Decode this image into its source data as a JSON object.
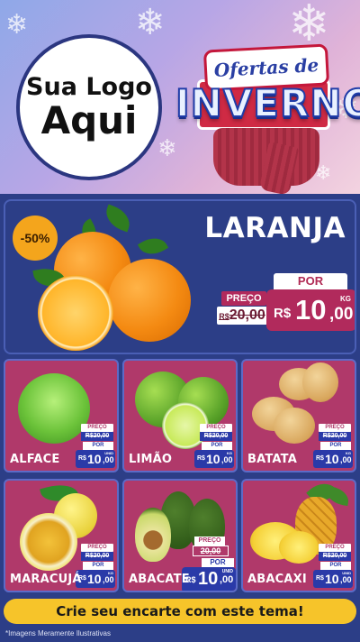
{
  "header": {
    "logo_line1": "Sua Logo",
    "logo_line2": "Aqui",
    "promo_top": "Ofertas de",
    "promo_main": "INVERNO"
  },
  "featured": {
    "name": "LARANJA",
    "discount": "-50%",
    "preco_label": "PREÇO",
    "old_currency": "R$",
    "old_price": "20,00",
    "por_label": "POR",
    "currency": "R$",
    "price_int": "10",
    "price_dec": ",00",
    "unit": "KG"
  },
  "products": [
    {
      "name": "ALFACE",
      "preco_label": "PREÇO",
      "old_price": "R$20,00",
      "por_label": "POR",
      "currency": "R$",
      "price_int": "10",
      "price_dec": ",00",
      "unit": "UNID"
    },
    {
      "name": "LIMÃO",
      "preco_label": "PREÇO",
      "old_price": "R$20,00",
      "por_label": "POR",
      "currency": "R$",
      "price_int": "10",
      "price_dec": ",00",
      "unit": "KG"
    },
    {
      "name": "BATATA",
      "preco_label": "PREÇO",
      "old_price": "R$20,00",
      "por_label": "POR",
      "currency": "R$",
      "price_int": "10",
      "price_dec": ",00",
      "unit": "KG"
    },
    {
      "name": "MARACUJÁ",
      "preco_label": "PREÇO",
      "old_price": "R$20,00",
      "por_label": "POR",
      "currency": "R$",
      "price_int": "10",
      "price_dec": ",00",
      "unit": "KG"
    },
    {
      "name": "ABACATE",
      "preco_label": "PREÇO",
      "old_price": "20,00",
      "por_label": "POR",
      "currency": "R$",
      "price_int": "10",
      "price_dec": ",00",
      "unit": "UNID"
    },
    {
      "name": "ABACAXI",
      "preco_label": "PREÇO",
      "old_price": "R$20,00",
      "por_label": "POR",
      "currency": "R$",
      "price_int": "10",
      "price_dec": ",00",
      "unit": "UNID"
    }
  ],
  "footer": {
    "cta": "Crie seu encarte com este tema!",
    "disclaimer": "*Imagens Meramente Ilustrativas"
  },
  "colors": {
    "background": "#2c3e87",
    "card": "#b0396a",
    "price_box": "#2a3aa8",
    "featured_price": "#b12a5c",
    "cta": "#f6c42a",
    "discount_badge": "#f4a51c"
  }
}
